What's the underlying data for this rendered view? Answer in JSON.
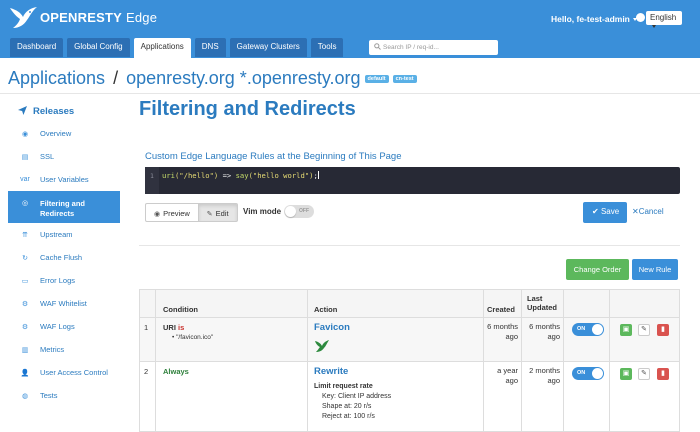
{
  "brand": {
    "name": "OPENRESTY",
    "product": "Edge"
  },
  "user_menu": {
    "label": "Hello, fe-test-admin"
  },
  "language": {
    "selected": "English"
  },
  "nav": {
    "tabs": [
      {
        "label": "Dashboard",
        "active": false
      },
      {
        "label": "Global Config",
        "active": false
      },
      {
        "label": "Applications",
        "active": true
      },
      {
        "label": "DNS",
        "active": false
      },
      {
        "label": "Gateway Clusters",
        "active": false
      },
      {
        "label": "Tools",
        "active": false
      }
    ],
    "search_placeholder": "Search IP / req-id..."
  },
  "app_header": {
    "section": "Applications",
    "separator": "/",
    "domains": "openresty.org *.openresty.org",
    "badges": [
      "default",
      "cn-test"
    ]
  },
  "sidebar": {
    "header": "Releases",
    "items": [
      {
        "label": "Overview",
        "icon": "overview-icon",
        "glyph": "◉",
        "active": false
      },
      {
        "label": "SSL",
        "icon": "ssl-icon",
        "glyph": "▤",
        "active": false
      },
      {
        "label": "User Variables",
        "icon": "variables-icon",
        "glyph": "var",
        "active": false
      },
      {
        "label": "Filtering and Redirects",
        "icon": "filter-icon",
        "glyph": "◎",
        "active": true
      },
      {
        "label": "Upstream",
        "icon": "upstream-icon",
        "glyph": "⇈",
        "active": false
      },
      {
        "label": "Cache Flush",
        "icon": "cache-icon",
        "glyph": "↻",
        "active": false
      },
      {
        "label": "Error Logs",
        "icon": "error-logs-icon",
        "glyph": "▭",
        "active": false
      },
      {
        "label": "WAF Whitelist",
        "icon": "waf-whitelist-icon",
        "glyph": "⚙",
        "active": false
      },
      {
        "label": "WAF Logs",
        "icon": "waf-logs-icon",
        "glyph": "⚙",
        "active": false
      },
      {
        "label": "Metrics",
        "icon": "metrics-icon",
        "glyph": "▥",
        "active": false
      },
      {
        "label": "User Access Control",
        "icon": "user-access-icon",
        "glyph": "👤",
        "active": false
      },
      {
        "label": "Tests",
        "icon": "tests-icon",
        "glyph": "◍",
        "active": false
      }
    ]
  },
  "page": {
    "title": "Filtering and Redirects",
    "rules_label": "Custom Edge Language Rules at the Beginning of This Page",
    "editor": {
      "line_number": "1",
      "code": {
        "fn1": "uri",
        "arg1": "(\"/hello\")",
        "arrow": " => ",
        "fn2": "say",
        "arg2": "(\"hello world\")",
        "end": ";"
      }
    },
    "preview_label": "Preview",
    "edit_label": "Edit",
    "vim_mode_label": "Vim mode",
    "vim_toggle_text": "OFF",
    "save_label": "Save",
    "cancel_label": "Cancel",
    "change_order_label": "Change Order",
    "new_rule_label": "New Rule"
  },
  "table": {
    "headers": {
      "condition": "Condition",
      "action": "Action",
      "created": "Created",
      "last_updated": "Last Updated"
    },
    "rows": [
      {
        "index": "1",
        "condition_keyword": "URI",
        "condition_op": "is",
        "condition_values": [
          "\"/favicon.ico\""
        ],
        "action_title": "Favicon",
        "created": "6 months ago",
        "updated": "6 months ago",
        "toggle": "ON"
      },
      {
        "index": "2",
        "condition_keyword": "Always",
        "action_title": "Rewrite",
        "action_detail_title": "Limit request rate",
        "action_details": [
          "Key: Client IP address",
          "Shape at: 20 r/s",
          "Reject at: 100 r/s"
        ],
        "created": "a year ago",
        "updated": "2 months ago",
        "toggle": "ON"
      }
    ]
  },
  "colors": {
    "primary": "#3a8fd9",
    "success": "#5cb85c",
    "danger": "#d9534f",
    "editor_bg": "#272935"
  }
}
